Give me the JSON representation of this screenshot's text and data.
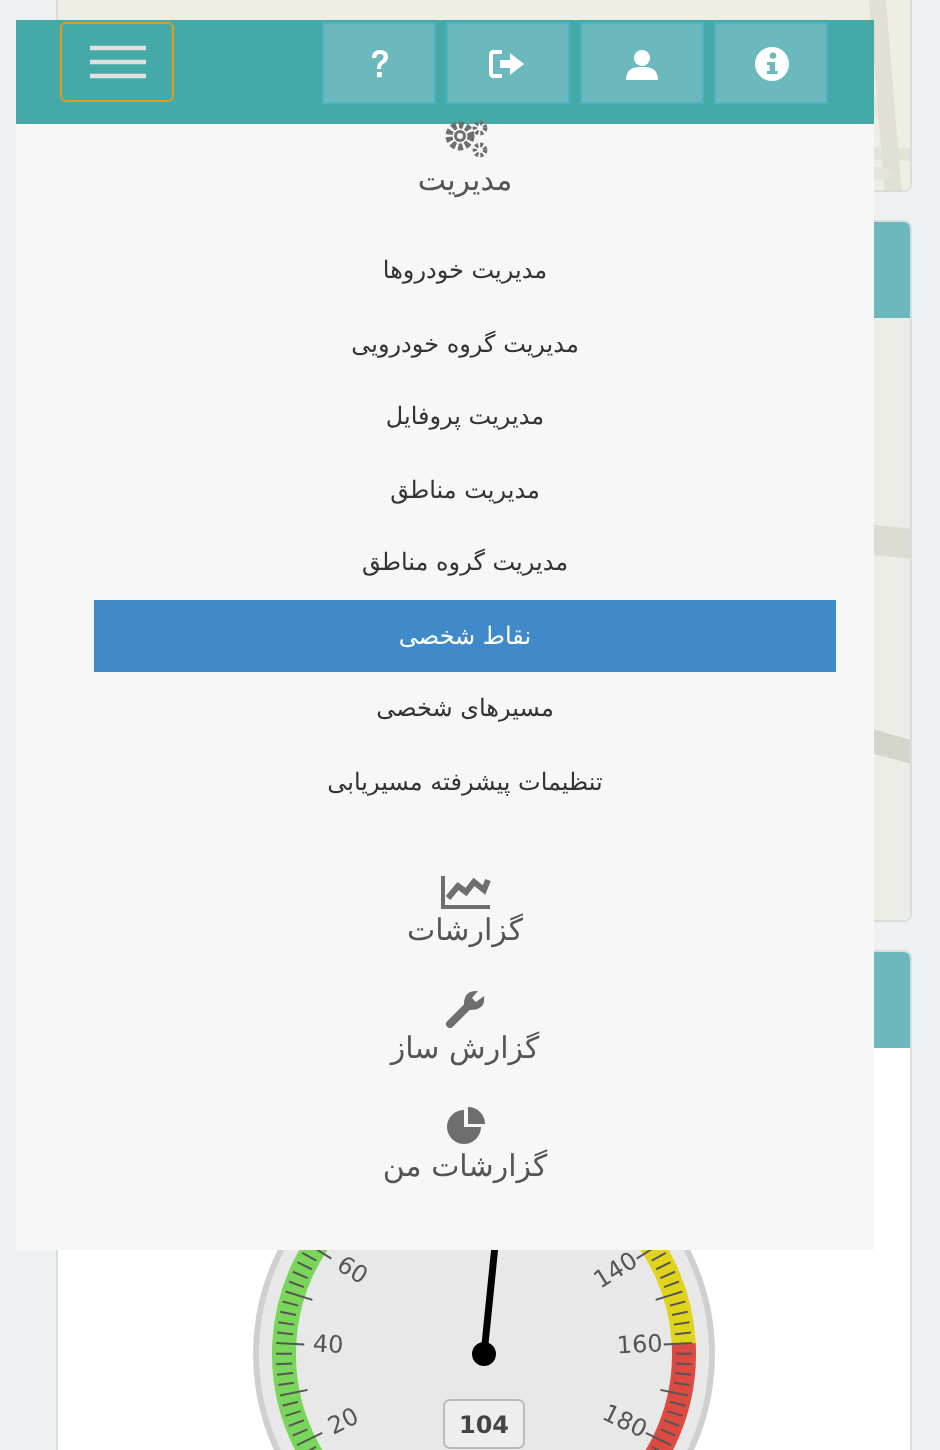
{
  "menu": {
    "sections": [
      {
        "kind": "gears",
        "title": "مدیریت",
        "items": [
          {
            "label": "مدیریت خودروها",
            "selected": false
          },
          {
            "label": "مدیریت گروه خودرویی",
            "selected": false
          },
          {
            "label": "مدیریت پروفایل",
            "selected": false
          },
          {
            "label": "مدیریت مناطق",
            "selected": false
          },
          {
            "label": "مدیریت گروه مناطق",
            "selected": false
          },
          {
            "label": "نقاط شخصی",
            "selected": true
          },
          {
            "label": "مسیرهای شخصی",
            "selected": false
          },
          {
            "label": "تنظیمات پیشرفته مسیریابی",
            "selected": false
          }
        ]
      },
      {
        "kind": "chart",
        "title": "گزارشات"
      },
      {
        "kind": "wrench",
        "title": "گزارش ساز"
      },
      {
        "kind": "pie",
        "title": "گزارشات من"
      }
    ]
  },
  "gauge": {
    "level": 0.52,
    "reading": "104",
    "tick_labels": [
      "20",
      "40",
      "60",
      "140",
      "160",
      "180"
    ]
  }
}
